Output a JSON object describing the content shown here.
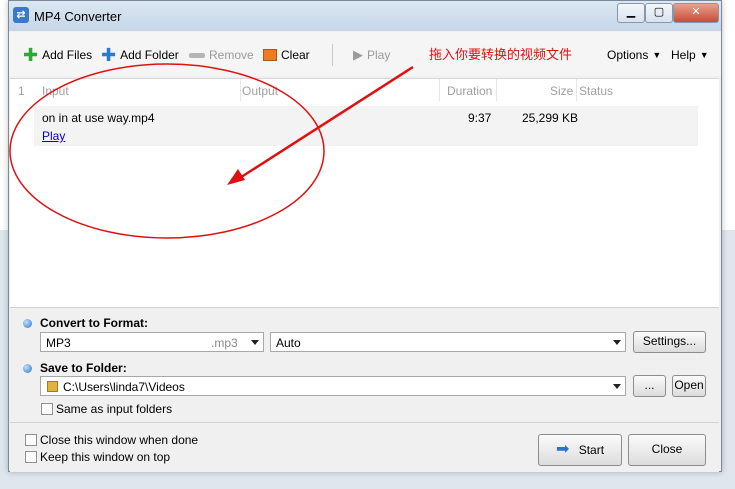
{
  "window": {
    "title": "MP4 Converter"
  },
  "toolbar": {
    "add_files": "Add Files",
    "add_folder": "Add Folder",
    "remove": "Remove",
    "clear": "Clear",
    "play": "Play",
    "options": "Options",
    "help": "Help"
  },
  "annotation": "拖入你要转换的视频文件",
  "list": {
    "headers": [
      "1",
      "Input",
      "Output",
      "Duration",
      "Size",
      "Status"
    ],
    "rows": [
      {
        "input": "on in at use way.mp4",
        "play_link": "Play",
        "duration": "9:37",
        "size": "25,299 KB"
      }
    ]
  },
  "convert": {
    "label": "Convert to Format:",
    "format": "MP3",
    "extension": ".mp3",
    "quality": "Auto",
    "settings_button": "Settings..."
  },
  "save": {
    "label": "Save to Folder:",
    "path": "C:\\Users\\linda7\\Videos",
    "browse_button": "...",
    "open_button": "Open",
    "same_as_input": "Same as input folders"
  },
  "footer": {
    "close_when_done": "Close this window when done",
    "keep_on_top": "Keep this window on top",
    "start_button": "Start",
    "close_button": "Close"
  },
  "colors": {
    "accent": "#2a74c8",
    "annotation": "#e01010"
  }
}
